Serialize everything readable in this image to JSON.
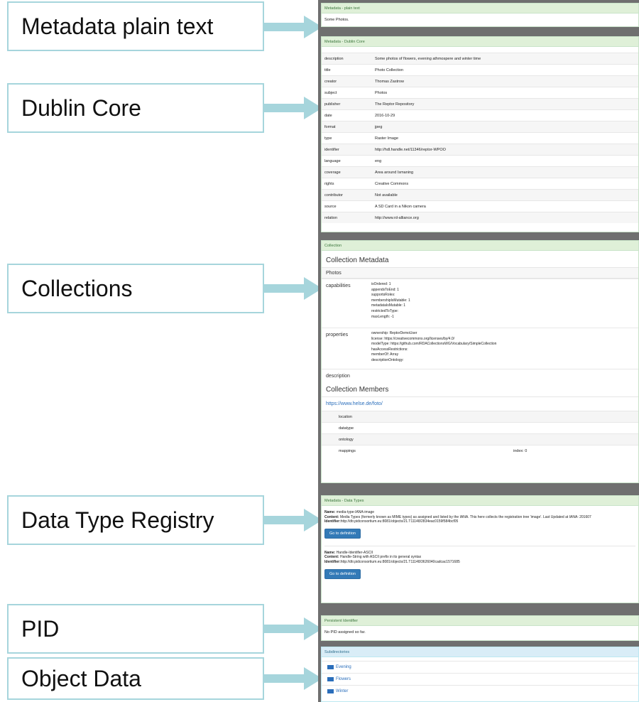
{
  "callouts": [
    "Metadata plain text",
    "Dublin Core",
    "Collections",
    "Data Type Registry",
    "PID",
    "Object Data"
  ],
  "colors": {
    "callout_border": "#a6d5dc",
    "arrow": "#a6d5dc",
    "panel_bg": "#6f6f6f",
    "success_header": "#dff0d8",
    "info_header": "#d9edf7",
    "button": "#337ab7"
  },
  "plain_text": {
    "header": "Metadata - plain text",
    "content": "Some Photos."
  },
  "dublin_core": {
    "header": "Metadata - Dublin Core",
    "rows": [
      {
        "key": "description",
        "value": "Some photos of flowers, evening athmospere and winter time"
      },
      {
        "key": "title",
        "value": "Photo Collection"
      },
      {
        "key": "creator",
        "value": "Thomas Zastrow"
      },
      {
        "key": "subject",
        "value": "Photos"
      },
      {
        "key": "publisher",
        "value": "The Reptor Repository"
      },
      {
        "key": "date",
        "value": "2016-10-29"
      },
      {
        "key": "format",
        "value": "jpeg"
      },
      {
        "key": "type",
        "value": "Raster Image"
      },
      {
        "key": "identifier",
        "value": "http://hdl.handle.net/11346/reptor-WPOO"
      },
      {
        "key": "language",
        "value": "eng"
      },
      {
        "key": "coverage",
        "value": "Area around Ismaning"
      },
      {
        "key": "rights",
        "value": "Creative Commons"
      },
      {
        "key": "contributor",
        "value": "Not available"
      },
      {
        "key": "source",
        "value": "A SD Card in a Nikon camera"
      },
      {
        "key": "relation",
        "value": "http://www.rd-alliance.org"
      }
    ]
  },
  "collection": {
    "header": "Collection",
    "title": "Collection Metadata",
    "name": "Photos",
    "capabilities_label": "capabilities",
    "capabilities": [
      "isOrdered: 1",
      "appendsToEnd: 1",
      "supportsRoles:",
      "membershipIsMutable: 1",
      "metadataIsMutable: 1",
      "restrictedToType:",
      "maxLength: -1"
    ],
    "properties_label": "properties",
    "properties": [
      "ownership: ReptorDemoUser",
      "license: https://creativecommons.org/licenses/by/4.0/",
      "modelType: https://github.com/RDACollectionsWG/Vocabulary/SimpleCollection",
      "hasAccessRestrictions:",
      "memberOf: Array",
      "descriptionOntology:"
    ],
    "description_label": "description",
    "members_title": "Collection Members",
    "member_link": "https://www.helse.de/foto/",
    "member_rows": [
      {
        "key": "location",
        "value": ""
      },
      {
        "key": "datatype",
        "value": ""
      },
      {
        "key": "ontology",
        "value": ""
      },
      {
        "key": "mappings",
        "value": "index: 0"
      }
    ]
  },
  "data_types": {
    "header": "Metadata - Data Types",
    "name_label": "Name:",
    "content_label": "Content:",
    "identifier_label": "Identifier:",
    "button_label": "Go to definition",
    "entries": [
      {
        "name": "media-type-IANA-image",
        "content": "Media Types (formerly known as MIME types) as assigned and listed by the IANA. This here collects the registration tree 'image'. Last Updated at IANA: 201607",
        "identifier": "http://dtr.pidconsortium.eu:8081/objects/21.T11148/2834eac0159f584bcf05"
      },
      {
        "name": "Handle-Identifier-ASCII",
        "content": "Handle-String with ASCII prefix in its general syntax",
        "identifier": "http://dtr.pidconsortium.eu:8081/objects/21.T11148/3626040cadcac1571685"
      }
    ]
  },
  "pid": {
    "header": "Persistent Identifier",
    "content": "No PID assigned so far."
  },
  "subdirectories": {
    "header": "Subdirectories",
    "folder_icon": "folder-icon",
    "items": [
      "Evening",
      "Flowers",
      "Winter"
    ]
  }
}
